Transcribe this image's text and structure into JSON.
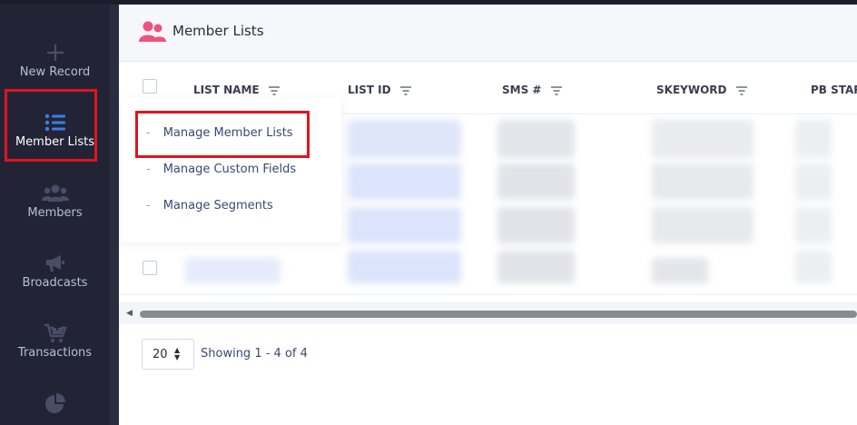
{
  "sidebar": {
    "items": [
      {
        "label": "New Record",
        "icon": "plus-icon"
      },
      {
        "label": "Member Lists",
        "icon": "list-icon",
        "active": true
      },
      {
        "label": "Members",
        "icon": "users-icon"
      },
      {
        "label": "Broadcasts",
        "icon": "megaphone-icon"
      },
      {
        "label": "Transactions",
        "icon": "cart-icon"
      },
      {
        "label": "",
        "icon": "pie-chart-icon"
      }
    ]
  },
  "header": {
    "title": "Member Lists",
    "icon": "member-lists-icon"
  },
  "table": {
    "columns": [
      {
        "label": "LIST NAME"
      },
      {
        "label": "LIST ID"
      },
      {
        "label": "SMS #"
      },
      {
        "label": "SKEYWORD"
      },
      {
        "label": "PB STAR"
      }
    ]
  },
  "dropdown": {
    "items": [
      {
        "label": "Manage Member Lists"
      },
      {
        "label": "Manage Custom Fields"
      },
      {
        "label": "Manage Segments"
      }
    ],
    "dash": "-"
  },
  "pagination": {
    "page_size": "20",
    "showing": "Showing 1 - 4 of 4"
  },
  "colors": {
    "accent": "#3f7de8",
    "highlight": "#e0141f",
    "sidebar": "#222436",
    "header_icon": "#f0507a"
  }
}
